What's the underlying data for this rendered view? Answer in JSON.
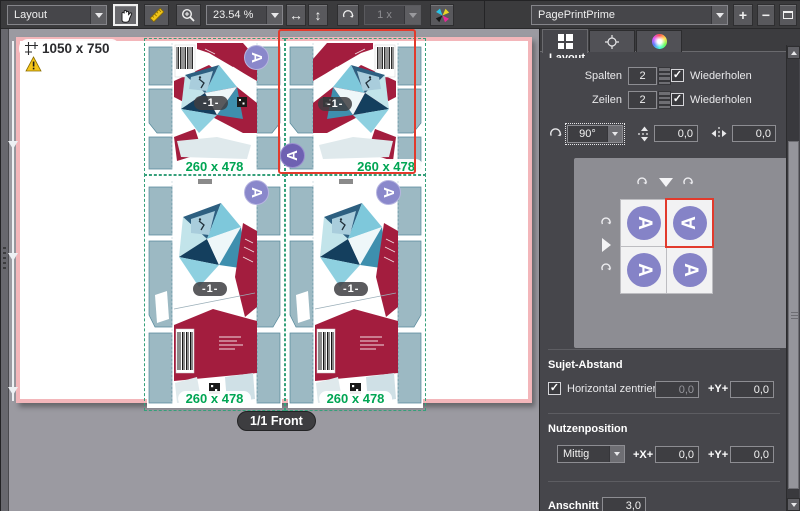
{
  "toolbar": {
    "mode_value": "Layout",
    "zoom_value": "23.54 %",
    "copies_value": "1 x",
    "preset_value": "PagePrintPrime",
    "add_label": "+",
    "remove_label": "−"
  },
  "canvas": {
    "sheet_size_label": "1050 x 750",
    "front_label": "1/1 Front",
    "units": [
      {
        "size_label": "260 x 478",
        "page_label": "-1-",
        "marker_letter": "A"
      },
      {
        "size_label": "260 x 478",
        "page_label": "-1-",
        "marker_letter": "A"
      },
      {
        "size_label": "260 x 478",
        "page_label": "-1-",
        "marker_letter": "A"
      },
      {
        "size_label": "260 x 478",
        "page_label": "-1-",
        "marker_letter": "A"
      }
    ]
  },
  "panel": {
    "group_label": "Layout",
    "columns": {
      "label": "Spalten",
      "value": "2",
      "repeat_label": "Wiederholen",
      "check_glyph": "✓"
    },
    "rows": {
      "label": "Zeilen",
      "value": "2",
      "repeat_label": "Wiederholen",
      "check_glyph": "✓"
    },
    "rotation": {
      "value": "90°",
      "v_gap_value": "0,0",
      "h_gap_value": "0,0"
    },
    "preview": {
      "cells": [
        {
          "letter": "A"
        },
        {
          "letter": "A"
        },
        {
          "letter": "A"
        },
        {
          "letter": "A"
        }
      ]
    },
    "sujet_abstand": {
      "title": "Sujet-Abstand",
      "checkbox_label": "Horizontal zentrieren",
      "check_glyph": "✓",
      "x_value": "0,0",
      "y_label": "+Y+",
      "y_value": "0,0"
    },
    "nutzenposition": {
      "title": "Nutzenposition",
      "align_value": "Mittig",
      "x_label": "+X+",
      "x_value": "0,0",
      "y_label": "+Y+",
      "y_value": "0,0"
    },
    "bleed": {
      "label": "Anschnitt",
      "value": "3,0"
    }
  },
  "colors": {
    "selection_red": "#e23a2c",
    "size_label_green": "#00a553",
    "marker_purple": "#8a88cb",
    "artwork_crimson": "#a31d3e",
    "artwork_teal": "#9cb9c3",
    "page_border_pink": "#f3b6ba"
  }
}
